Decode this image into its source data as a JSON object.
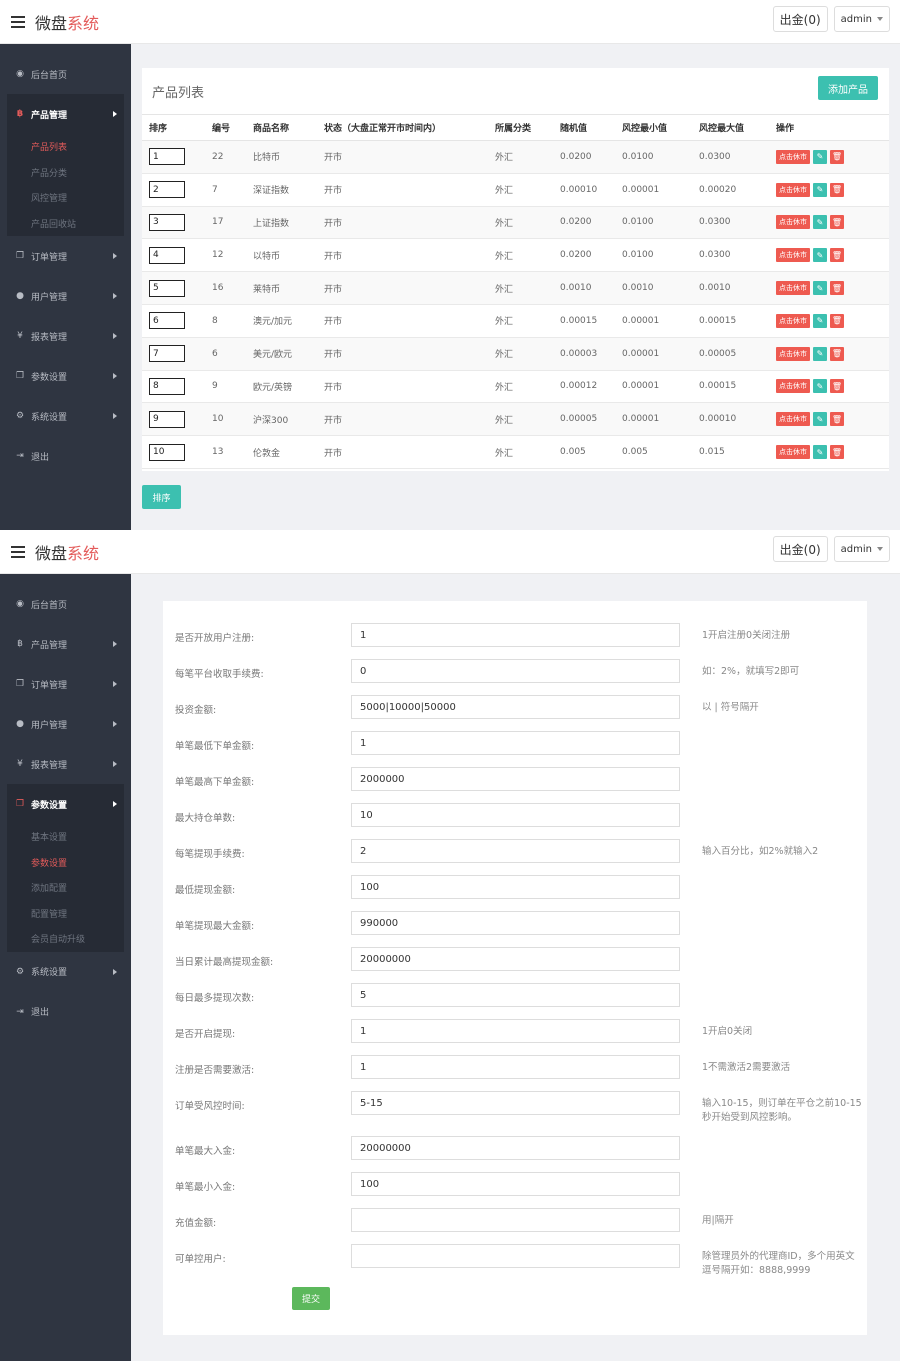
{
  "brand": {
    "main": "微盘",
    "accent": "系统"
  },
  "topbar": {
    "withdraw": "出金(0)",
    "user": "admin"
  },
  "sidebar": {
    "dashboard": "后台首页",
    "product": "产品管理",
    "product_sub": [
      "产品列表",
      "产品分类",
      "风控管理",
      "产品回收站"
    ],
    "order": "订单管理",
    "user": "用户管理",
    "report": "报表管理",
    "params": "参数设置",
    "params_sub": [
      "基本设置",
      "参数设置",
      "添加配置",
      "配置管理",
      "会员自动升级"
    ],
    "system": "系统设置",
    "logout": "退出"
  },
  "product_list": {
    "title": "产品列表",
    "add_label": "添加产品",
    "sort_label": "排序",
    "columns": [
      "排序",
      "编号",
      "商品名称",
      "状态（大盘正常开市时间内）",
      "所属分类",
      "随机值",
      "风控最小值",
      "风控最大值",
      "操作"
    ],
    "op_label": "点击休市",
    "edit_icon": "✎",
    "delete_icon": "🗑",
    "rows": [
      {
        "sort": "1",
        "id": "22",
        "name": "比特币",
        "status": "开市",
        "category": "外汇",
        "random": "0.0200",
        "min": "0.0100",
        "max": "0.0300"
      },
      {
        "sort": "2",
        "id": "7",
        "name": "深证指数",
        "status": "开市",
        "category": "外汇",
        "random": "0.00010",
        "min": "0.00001",
        "max": "0.00020"
      },
      {
        "sort": "3",
        "id": "17",
        "name": "上证指数",
        "status": "开市",
        "category": "外汇",
        "random": "0.0200",
        "min": "0.0100",
        "max": "0.0300"
      },
      {
        "sort": "4",
        "id": "12",
        "name": "以特币",
        "status": "开市",
        "category": "外汇",
        "random": "0.0200",
        "min": "0.0100",
        "max": "0.0300"
      },
      {
        "sort": "5",
        "id": "16",
        "name": "莱特币",
        "status": "开市",
        "category": "外汇",
        "random": "0.0010",
        "min": "0.0010",
        "max": "0.0010"
      },
      {
        "sort": "6",
        "id": "8",
        "name": "澳元/加元",
        "status": "开市",
        "category": "外汇",
        "random": "0.00015",
        "min": "0.00001",
        "max": "0.00015"
      },
      {
        "sort": "7",
        "id": "6",
        "name": "美元/欧元",
        "status": "开市",
        "category": "外汇",
        "random": "0.00003",
        "min": "0.00001",
        "max": "0.00005"
      },
      {
        "sort": "8",
        "id": "9",
        "name": "欧元/英镑",
        "status": "开市",
        "category": "外汇",
        "random": "0.00012",
        "min": "0.00001",
        "max": "0.00015"
      },
      {
        "sort": "9",
        "id": "10",
        "name": "沪深300",
        "status": "开市",
        "category": "外汇",
        "random": "0.00005",
        "min": "0.00001",
        "max": "0.00010"
      },
      {
        "sort": "10",
        "id": "13",
        "name": "伦敦金",
        "status": "开市",
        "category": "外汇",
        "random": "0.005",
        "min": "0.005",
        "max": "0.015"
      }
    ]
  },
  "settings": {
    "submit_label": "提交",
    "fields": [
      {
        "label": "是否开放用户注册:",
        "value": "1",
        "hint": "1开启注册0关闭注册"
      },
      {
        "label": "每笔平台收取手续费:",
        "value": "0",
        "hint": "如：2%，就填写2即可"
      },
      {
        "label": "投资金额:",
        "value": "5000|10000|50000",
        "hint": "以 | 符号隔开"
      },
      {
        "label": "单笔最低下单金额:",
        "value": "1",
        "hint": ""
      },
      {
        "label": "单笔最高下单金额:",
        "value": "2000000",
        "hint": ""
      },
      {
        "label": "最大持仓单数:",
        "value": "10",
        "hint": ""
      },
      {
        "label": "每笔提现手续费:",
        "value": "2",
        "hint": "输入百分比，如2%就输入2"
      },
      {
        "label": "最低提现金额:",
        "value": "100",
        "hint": ""
      },
      {
        "label": "单笔提现最大金额:",
        "value": "990000",
        "hint": ""
      },
      {
        "label": "当日累计最高提现金额:",
        "value": "20000000",
        "hint": ""
      },
      {
        "label": "每日最多提现次数:",
        "value": "5",
        "hint": ""
      },
      {
        "label": "是否开启提现:",
        "value": "1",
        "hint": "1开启0关闭"
      },
      {
        "label": "注册是否需要激活:",
        "value": "1",
        "hint": "1不需激活2需要激活"
      },
      {
        "label": "订单受风控时间:",
        "value": "5-15",
        "hint": "输入10-15，则订单在平仓之前10-15秒开始受到风控影响。"
      },
      {
        "label": "单笔最大入金:",
        "value": "20000000",
        "hint": ""
      },
      {
        "label": "单笔最小入金:",
        "value": "100",
        "hint": ""
      },
      {
        "label": "充值金额:",
        "value": "",
        "hint": "用|隔开"
      },
      {
        "label": "可单控用户:",
        "value": "",
        "hint": "除管理员外的代理商ID，多个用英文逗号隔开如：8888,9999"
      }
    ]
  }
}
